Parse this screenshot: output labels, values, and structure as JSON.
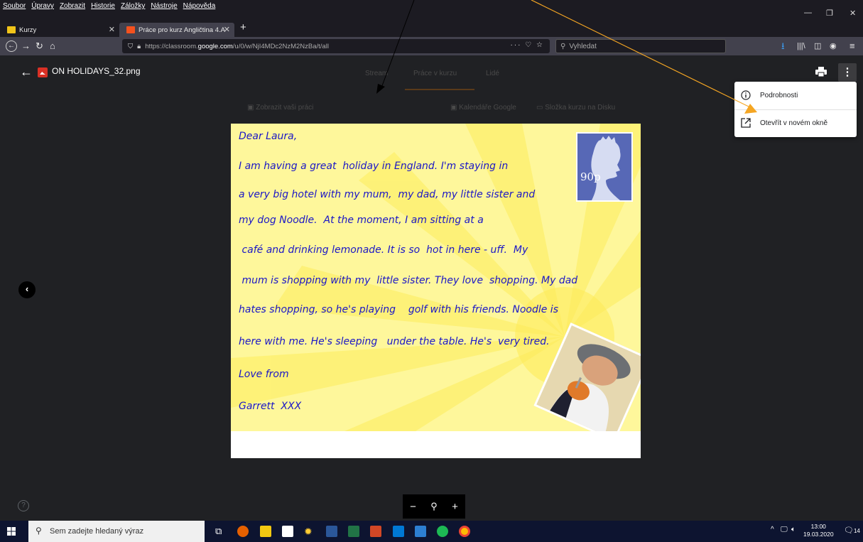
{
  "browser": {
    "menu": [
      "Soubor",
      "Úpravy",
      "Zobrazit",
      "Historie",
      "Záložky",
      "Nástroje",
      "Nápověda"
    ],
    "tabs": [
      {
        "label": "Kurzy",
        "active": false
      },
      {
        "label": "Práce pro kurz Angličtina 4.A",
        "active": true
      }
    ],
    "new_tab": "+",
    "url_prefix": "https://classroom.",
    "url_domain": "google.com",
    "url_suffix": "/u/0/w/NjI4MDc2NzM2NzBa/t/all",
    "url_actions": "··· ♡ ☆",
    "search_placeholder": "Vyhledat"
  },
  "viewer": {
    "file_name": "ON HOLIDAYS_32.png",
    "background_tabs": [
      "Stream",
      "Práce v kurzu",
      "Lidé"
    ],
    "background_links": [
      "Zobrazit vaši práci",
      "Kalendáře Google",
      "Složka kurzu na Disku"
    ],
    "menu_items": [
      {
        "label": "Podrobnosti",
        "icon": "info-icon"
      },
      {
        "label": "Otevřít v novém okně",
        "icon": "open-new-window-icon"
      }
    ],
    "zoom": {
      "minus": "−",
      "search": "⚲",
      "plus": "+"
    },
    "help": "?"
  },
  "postcard": {
    "lines": [
      "Dear Laura,",
      "I am having a great  holiday in England. I'm staying in",
      "a very big hotel with my mum,  my dad, my little sister and",
      "my dog Noodle.  At the moment, I am sitting at a",
      " café and drinking lemonade. It is so  hot in here - uff.  My",
      " mum is shopping with my  little sister. They love  shopping. My dad",
      "hates shopping, so he's playing    golf with his friends. Noodle is",
      "here with me. He's sleeping   under the table. He's  very tired.",
      "Love from",
      "Garrett  XXX"
    ],
    "stamp_value": "90p"
  },
  "taskbar": {
    "search_placeholder": "Sem zadejte hledaný výraz",
    "time": "13:00",
    "date": "19.03.2020",
    "notifications": "14"
  },
  "colors": {
    "annotation_arrow": "#f5a623",
    "postcard_text": "#1b17c6",
    "postcard_bg": "#fef79b"
  }
}
